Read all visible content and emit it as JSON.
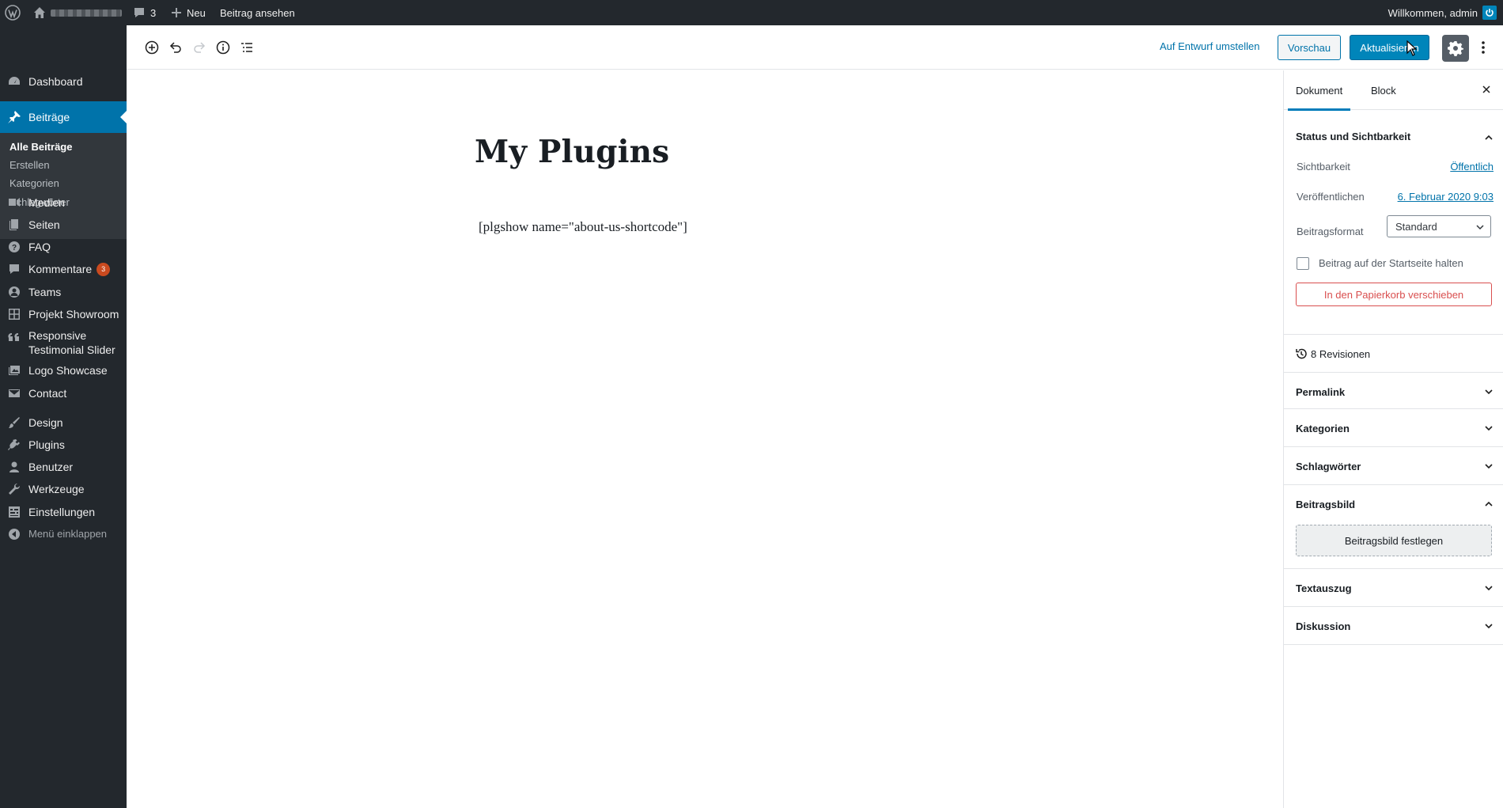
{
  "admin_bar": {
    "comments_count": "3",
    "new_label": "Neu",
    "view_post_label": "Beitrag ansehen",
    "welcome": "Willkommen, admin"
  },
  "sidebar": {
    "items": [
      {
        "label": "Dashboard",
        "icon": "dashboard-icon"
      },
      {
        "label": "Beiträge",
        "icon": "pin-icon"
      },
      {
        "label": "Medien",
        "icon": "media-icon"
      },
      {
        "label": "Seiten",
        "icon": "pages-icon"
      },
      {
        "label": "FAQ",
        "icon": "help-icon"
      },
      {
        "label": "Kommentare",
        "icon": "comments-icon",
        "badge": "3"
      },
      {
        "label": "Teams",
        "icon": "teams-icon"
      },
      {
        "label": "Projekt Showroom",
        "icon": "grid-icon"
      },
      {
        "label": "Responsive\nTestimonial Slider",
        "icon": "quote-icon"
      },
      {
        "label": "Logo Showcase",
        "icon": "images-icon"
      },
      {
        "label": "Contact",
        "icon": "email-icon"
      },
      {
        "label": "Design",
        "icon": "brush-icon"
      },
      {
        "label": "Plugins",
        "icon": "plugin-icon"
      },
      {
        "label": "Benutzer",
        "icon": "user-icon"
      },
      {
        "label": "Werkzeuge",
        "icon": "wrench-icon"
      },
      {
        "label": "Einstellungen",
        "icon": "settings-icon"
      },
      {
        "label": "Menü einklappen",
        "icon": "collapse-icon"
      }
    ],
    "submenu": [
      "Alle Beiträge",
      "Erstellen",
      "Kategorien",
      "Schlagwörter"
    ]
  },
  "toolbar": {
    "switch_draft": "Auf Entwurf umstellen",
    "preview": "Vorschau",
    "update": "Aktualisieren"
  },
  "post": {
    "title": "My Plugins",
    "content": "[plgshow name=\"about-us-shortcode\"]"
  },
  "settings": {
    "tabs": [
      "Dokument",
      "Block"
    ],
    "status_panel": {
      "title": "Status und Sichtbarkeit",
      "visibility_label": "Sichtbarkeit",
      "visibility_value": "Öffentlich",
      "publish_label": "Veröffentlichen",
      "publish_value": "6. Februar 2020 9:03",
      "format_label": "Beitragsformat",
      "format_value": "Standard",
      "sticky_label": "Beitrag auf der Startseite halten",
      "trash_label": "In den Papierkorb verschieben"
    },
    "revisions": "8 Revisionen",
    "panels": [
      "Permalink",
      "Kategorien",
      "Schlagwörter"
    ],
    "featured_image": {
      "title": "Beitragsbild",
      "button": "Beitragsbild festlegen"
    },
    "panels_bottom": [
      "Textauszug",
      "Diskussion"
    ]
  },
  "colors": {
    "admin_dark": "#23282d",
    "accent": "#0073aa",
    "primary_button": "#0085ba",
    "danger": "#d94f4f",
    "badge": "#ca4a1f"
  }
}
